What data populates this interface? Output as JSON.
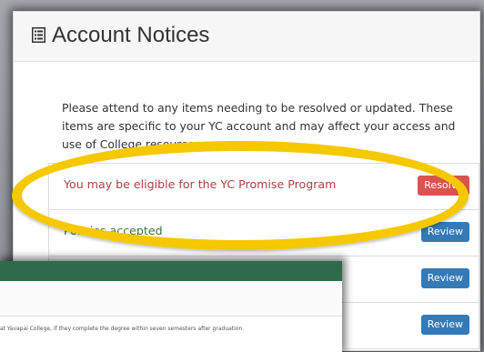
{
  "header": {
    "title": "Account Notices",
    "icon": "list-icon"
  },
  "intro": "Please attend to any items needing to be resolved or updated. These items are specific to your YC account and may affect your access and use of College resources.",
  "notices": [
    {
      "label": "You may be eligible for the YC Promise Program",
      "label_color": "#a94442",
      "button": "Resolve",
      "button_color": "#d9534f"
    },
    {
      "label": "Policies accepted",
      "label_color": "#3c763d",
      "button": "Review",
      "button_color": "#337ab7"
    },
    {
      "label": "",
      "label_color": "#333333",
      "button": "Review",
      "button_color": "#337ab7"
    },
    {
      "label": "",
      "label_color": "#333333",
      "button": "Review",
      "button_color": "#337ab7"
    }
  ],
  "highlight_color": "#f6c800",
  "popup": {
    "bar_color": "#2f6b4a",
    "text": "at Yavapai College, if they complete the degree within seven semesters after graduation."
  }
}
